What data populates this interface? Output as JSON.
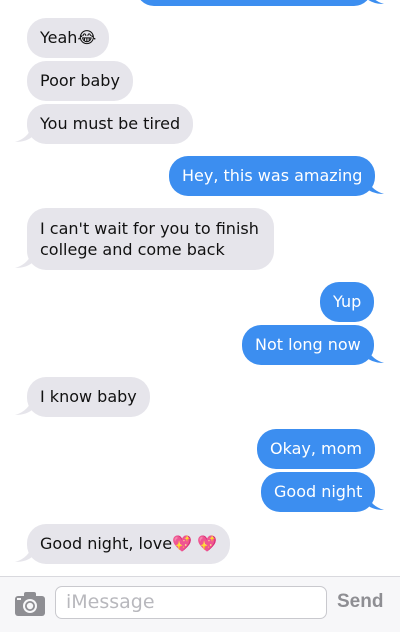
{
  "messages": [
    {
      "side": "in",
      "text": "Yeah😂"
    },
    {
      "side": "in",
      "text": "Poor baby"
    },
    {
      "side": "in",
      "text": "You must be tired"
    },
    {
      "side": "out",
      "text": "Hey, this was amazing"
    },
    {
      "side": "in",
      "text": "I can't wait for you to finish college and come back"
    },
    {
      "side": "out",
      "text": "Yup"
    },
    {
      "side": "out",
      "text": "Not long now"
    },
    {
      "side": "in",
      "text": "I know baby"
    },
    {
      "side": "out",
      "text": "Okay, mom"
    },
    {
      "side": "out",
      "text": "Good night"
    },
    {
      "side": "in",
      "text": "Good night, love💖 💖"
    }
  ],
  "composer": {
    "placeholder": "iMessage",
    "send_label": "Send",
    "camera_icon": "camera-icon"
  },
  "colors": {
    "incoming_bubble": "#e6e5eb",
    "outgoing_bubble": "#3c8ef0",
    "send_disabled": "#8e8e93"
  }
}
